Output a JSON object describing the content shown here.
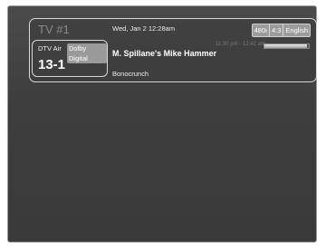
{
  "banner": {
    "tv_name": "TV #1",
    "datetime": "Wed, Jan 2  12:28am",
    "badges": [
      "480i",
      "4:3",
      "English"
    ],
    "channel": {
      "source": "DTV Air",
      "audio": "Dolby Digital",
      "number": "13-1"
    },
    "program_title": "M. Spillane's Mike Hammer",
    "time_range": "11:30 pm - 12:42 am",
    "progress_fraction": 0.95,
    "description": "Bonocrunch"
  },
  "colors": {
    "background": "#3e3e3e",
    "border": "#d8d8d8",
    "badge": "#9c9c9c"
  }
}
